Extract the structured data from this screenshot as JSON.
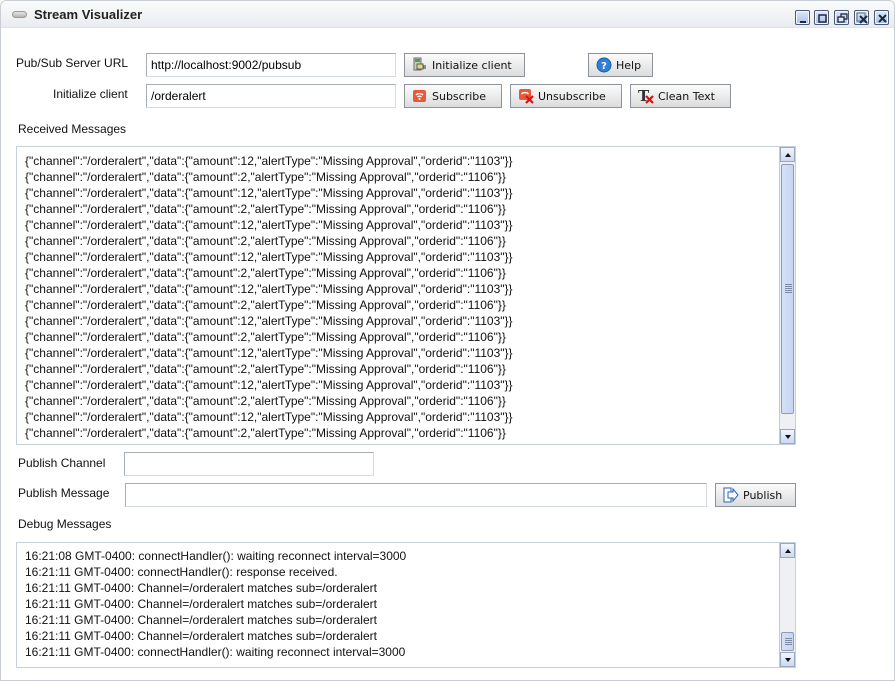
{
  "window": {
    "title": "Stream Visualizer",
    "controls": [
      "minimize-icon",
      "maximize-icon",
      "restore-icon",
      "close-all-icon",
      "close-icon"
    ]
  },
  "form": {
    "server_url_label": "Pub/Sub Server URL",
    "server_url_value": "http://localhost:9002/pubsub",
    "channel_label": "Initialize client",
    "channel_value": "/orderalert",
    "received_label": "Received Messages",
    "publish_channel_label": "Publish Channel",
    "publish_channel_value": "",
    "publish_message_label": "Publish Message",
    "publish_message_value": "",
    "debug_label": "Debug Messages"
  },
  "buttons": {
    "initialize": "Initialize client",
    "help": "Help",
    "subscribe": "Subscribe",
    "unsubscribe": "Unsubscribe",
    "clean_text": "Clean Text",
    "publish": "Publish"
  },
  "received_messages": [
    "{\"channel\":\"/orderalert\",\"data\":{\"amount\":12,\"alertType\":\"Missing Approval\",\"orderid\":\"1103\"}}",
    "{\"channel\":\"/orderalert\",\"data\":{\"amount\":2,\"alertType\":\"Missing Approval\",\"orderid\":\"1106\"}}",
    "{\"channel\":\"/orderalert\",\"data\":{\"amount\":12,\"alertType\":\"Missing Approval\",\"orderid\":\"1103\"}}",
    "{\"channel\":\"/orderalert\",\"data\":{\"amount\":2,\"alertType\":\"Missing Approval\",\"orderid\":\"1106\"}}",
    "{\"channel\":\"/orderalert\",\"data\":{\"amount\":12,\"alertType\":\"Missing Approval\",\"orderid\":\"1103\"}}",
    "{\"channel\":\"/orderalert\",\"data\":{\"amount\":2,\"alertType\":\"Missing Approval\",\"orderid\":\"1106\"}}",
    "{\"channel\":\"/orderalert\",\"data\":{\"amount\":12,\"alertType\":\"Missing Approval\",\"orderid\":\"1103\"}}",
    "{\"channel\":\"/orderalert\",\"data\":{\"amount\":2,\"alertType\":\"Missing Approval\",\"orderid\":\"1106\"}}",
    "{\"channel\":\"/orderalert\",\"data\":{\"amount\":12,\"alertType\":\"Missing Approval\",\"orderid\":\"1103\"}}",
    "{\"channel\":\"/orderalert\",\"data\":{\"amount\":2,\"alertType\":\"Missing Approval\",\"orderid\":\"1106\"}}",
    "{\"channel\":\"/orderalert\",\"data\":{\"amount\":12,\"alertType\":\"Missing Approval\",\"orderid\":\"1103\"}}",
    "{\"channel\":\"/orderalert\",\"data\":{\"amount\":2,\"alertType\":\"Missing Approval\",\"orderid\":\"1106\"}}",
    "{\"channel\":\"/orderalert\",\"data\":{\"amount\":12,\"alertType\":\"Missing Approval\",\"orderid\":\"1103\"}}",
    "{\"channel\":\"/orderalert\",\"data\":{\"amount\":2,\"alertType\":\"Missing Approval\",\"orderid\":\"1106\"}}",
    "{\"channel\":\"/orderalert\",\"data\":{\"amount\":12,\"alertType\":\"Missing Approval\",\"orderid\":\"1103\"}}",
    "{\"channel\":\"/orderalert\",\"data\":{\"amount\":2,\"alertType\":\"Missing Approval\",\"orderid\":\"1106\"}}",
    "{\"channel\":\"/orderalert\",\"data\":{\"amount\":12,\"alertType\":\"Missing Approval\",\"orderid\":\"1103\"}}",
    "{\"channel\":\"/orderalert\",\"data\":{\"amount\":2,\"alertType\":\"Missing Approval\",\"orderid\":\"1106\"}}"
  ],
  "debug_messages": [
    "16:21:08 GMT-0400: connectHandler(): waiting reconnect interval=3000",
    "16:21:11 GMT-0400: connectHandler(): response received.",
    "16:21:11 GMT-0400: Channel=/orderalert matches sub=/orderalert",
    "16:21:11 GMT-0400: Channel=/orderalert matches sub=/orderalert",
    "16:21:11 GMT-0400: Channel=/orderalert matches sub=/orderalert",
    "16:21:11 GMT-0400: Channel=/orderalert matches sub=/orderalert",
    "16:21:11 GMT-0400: connectHandler(): waiting reconnect interval=3000"
  ],
  "scroll": {
    "received_position": "top",
    "debug_position": "bottom"
  },
  "colors": {
    "scrollbar_thumb": "#c9d7f3",
    "button_bg": "#e6e6e6",
    "subscribe_icon": "#e8593a",
    "help_icon": "#2f7fd6"
  }
}
